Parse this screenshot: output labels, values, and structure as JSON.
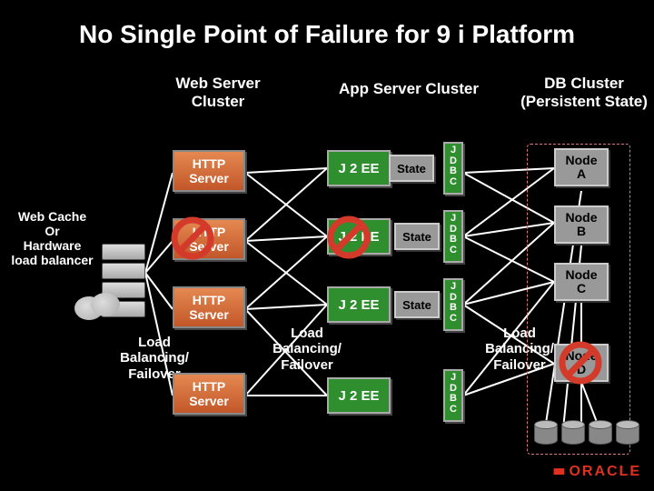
{
  "title": "No Single Point of Failure for 9 i Platform",
  "columns": {
    "web": "Web Server\nCluster",
    "app": "App Server Cluster",
    "db": "DB Cluster\n(Persistent State)"
  },
  "side_label": "Web Cache\nOr\nHardware\nload balancer",
  "lb_labels": {
    "left": "Load\nBalancing/\nFailover",
    "mid": "Load\nBalancing/\nFailover",
    "right": "Load\nBalancing/\nFailover"
  },
  "http": {
    "label": "HTTP\nServer",
    "count": 4,
    "failed_index": 1
  },
  "app_rows": [
    {
      "j2ee": "J 2 EE",
      "state": "State",
      "jdbc": "J\nD\nB\nC"
    },
    {
      "j2ee": "J 2 EE",
      "state": "State",
      "jdbc": "J\nD\nB\nC"
    },
    {
      "j2ee": "J 2 EE",
      "state": "State",
      "jdbc": "J\nD\nB\nC"
    },
    {
      "j2ee": "J 2 EE",
      "state": null,
      "jdbc": "J\nD\nB\nC"
    }
  ],
  "nodes": [
    {
      "label": "Node\nA",
      "failed": false
    },
    {
      "label": "Node\nB",
      "failed": false
    },
    {
      "label": "Node\nC",
      "failed": false
    },
    {
      "label": "Node\nD",
      "failed": true
    }
  ],
  "logo": {
    "word": "ORACLE"
  },
  "colors": {
    "http_box": "#c2572a",
    "j2ee_box": "#2f8f2f",
    "state_box": "#999999",
    "node_box": "#999999",
    "no_symbol": "#d43a2a"
  }
}
